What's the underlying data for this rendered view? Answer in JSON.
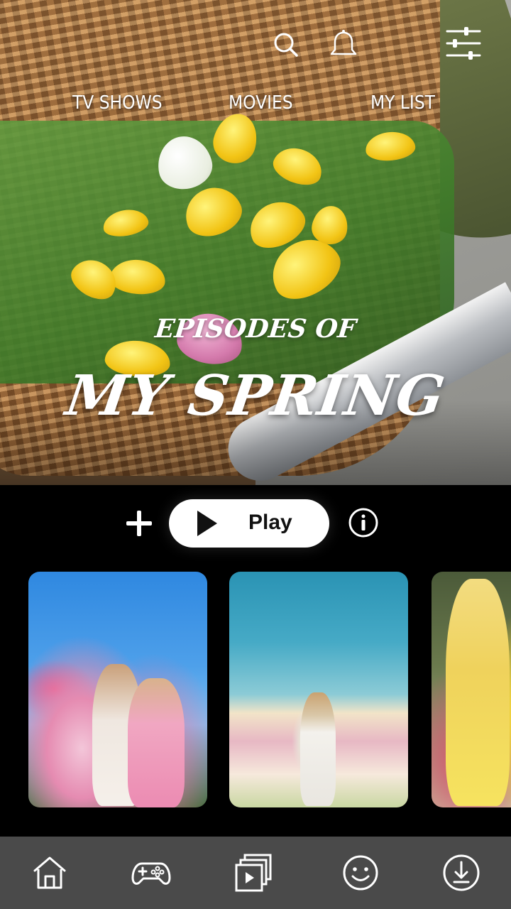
{
  "header": {
    "nav": {
      "tv_shows": "TV SHOWS",
      "movies": "MOVIES",
      "my_list": "MY LIST"
    },
    "icons": [
      "search-icon",
      "bell-icon",
      "filter-icon"
    ]
  },
  "hero": {
    "title_line1": "EPISODES OF",
    "title_line2": "MY SPRING"
  },
  "actions": {
    "play_label": "Play",
    "add_icon": "plus-icon",
    "info_icon": "info-icon"
  },
  "bottom_nav": {
    "items": [
      "home-icon",
      "gamepad-icon",
      "clips-icon",
      "profile-icon",
      "download-icon"
    ]
  },
  "colors": {
    "background": "#000000",
    "bottom_nav": "#4a4a4a",
    "play_button": "#ffffff"
  }
}
